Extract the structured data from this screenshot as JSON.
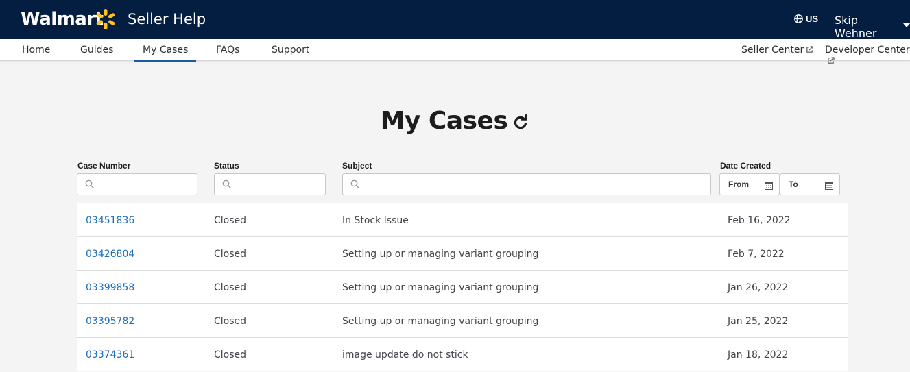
{
  "header": {
    "brand": "Walmart",
    "product": "Seller Help",
    "region": "US",
    "user": "Skip Wehner",
    "brand_color": "#041e42",
    "spark_color": "#ffc220"
  },
  "nav": {
    "items": [
      {
        "label": "Home"
      },
      {
        "label": "Guides"
      },
      {
        "label": "My Cases"
      },
      {
        "label": "FAQs"
      },
      {
        "label": "Support"
      }
    ],
    "active": "My Cases",
    "external": [
      {
        "label": "Seller Center",
        "icon": "external-link-icon"
      },
      {
        "label": "Developer Center",
        "icon": "external-link-icon"
      }
    ]
  },
  "page": {
    "title": "My Cases",
    "refresh_icon": "refresh-icon"
  },
  "filters": {
    "case_number_label": "Case Number",
    "status_label": "Status",
    "subject_label": "Subject",
    "date_label": "Date Created",
    "from_label": "From",
    "to_label": "To",
    "case_number_value": "",
    "status_value": "",
    "subject_value": ""
  },
  "cases": [
    {
      "number": "03451836",
      "status": "Closed",
      "subject": "In Stock Issue",
      "date": "Feb 16, 2022"
    },
    {
      "number": "03426804",
      "status": "Closed",
      "subject": "Setting up or managing variant grouping",
      "date": "Feb 7, 2022"
    },
    {
      "number": "03399858",
      "status": "Closed",
      "subject": "Setting up or managing variant grouping",
      "date": "Jan 26, 2022"
    },
    {
      "number": "03395782",
      "status": "Closed",
      "subject": "Setting up or managing variant grouping",
      "date": "Jan 25, 2022"
    },
    {
      "number": "03374361",
      "status": "Closed",
      "subject": "image update do not stick",
      "date": "Jan 18, 2022"
    }
  ]
}
